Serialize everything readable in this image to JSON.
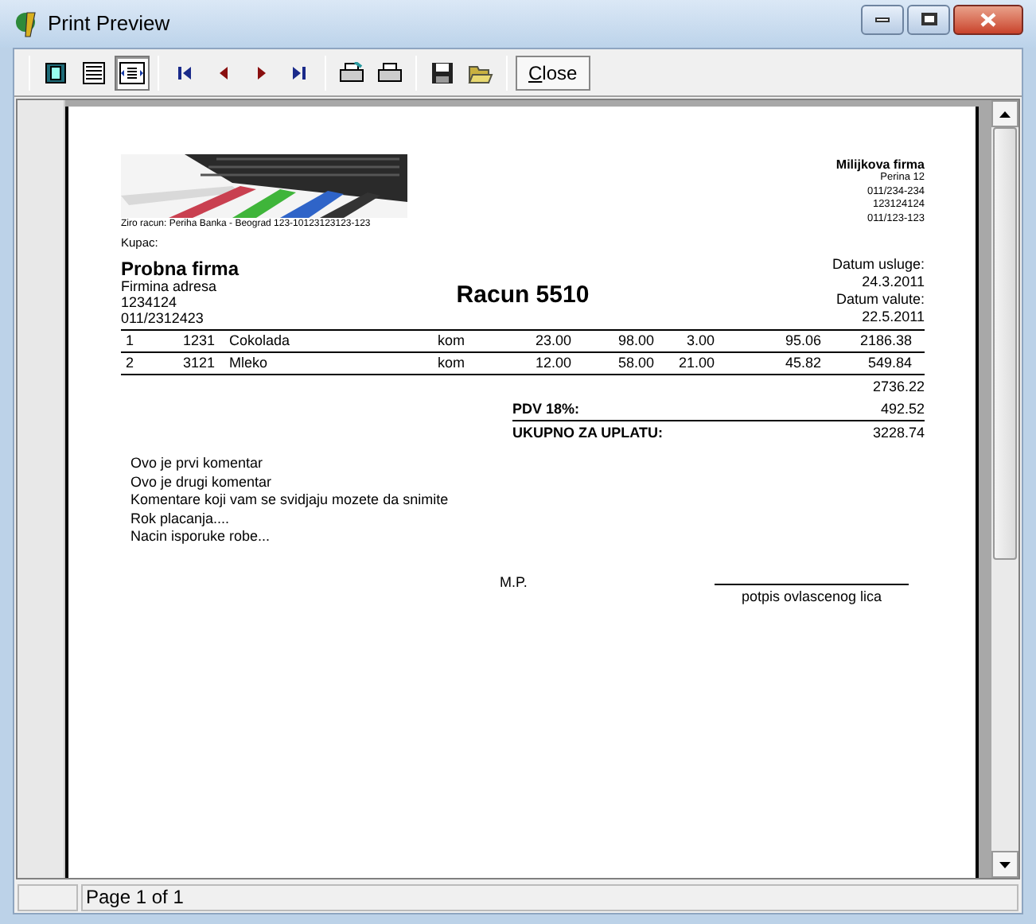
{
  "window": {
    "title": "Print Preview"
  },
  "toolbar": {
    "view_buttons": [
      {
        "selected": false
      },
      {
        "selected": false
      },
      {
        "selected": true
      }
    ],
    "close_button": "Close"
  },
  "document": {
    "bank_account": "Ziro racun: Periha Banka - Beograd 123-10123123123-123",
    "seller": {
      "name": "Milijkova firma",
      "lines": [
        "Perina 12",
        "011/234-234",
        "123124124",
        "011/123-123"
      ]
    },
    "buyer_label": "Kupac:",
    "buyer": {
      "name": "Probna firma",
      "lines": [
        "Firmina adresa",
        "1234124",
        "011/2312423"
      ]
    },
    "title": "Racun 5510",
    "dates": [
      "Datum usluge:",
      "24.3.2011",
      "Datum valute:",
      "22.5.2011"
    ],
    "rows": [
      [
        "1",
        "1231",
        "Cokolada",
        "kom",
        "23.00",
        "98.00",
        "3.00",
        "95.06",
        "2186.38"
      ],
      [
        "2",
        "3121",
        "Mleko",
        "kom",
        "12.00",
        "58.00",
        "21.00",
        "45.82",
        "549.84"
      ]
    ],
    "subtotal": "2736.22",
    "vat_label": "PDV 18%:",
    "vat": "492.52",
    "total_label": "UKUPNO ZA UPLATU:",
    "total": "3228.74",
    "comments": [
      "Ovo je prvi komentar",
      "Ovo je drugi komentar",
      "Komentare koji vam se svidjaju mozete da snimite",
      "Rok placanja....",
      "Nacin isporuke robe..."
    ],
    "stamp": "M.P.",
    "signature": "potpis ovlascenog lica"
  },
  "status_bar": {
    "page": "Page 1 of 1"
  }
}
